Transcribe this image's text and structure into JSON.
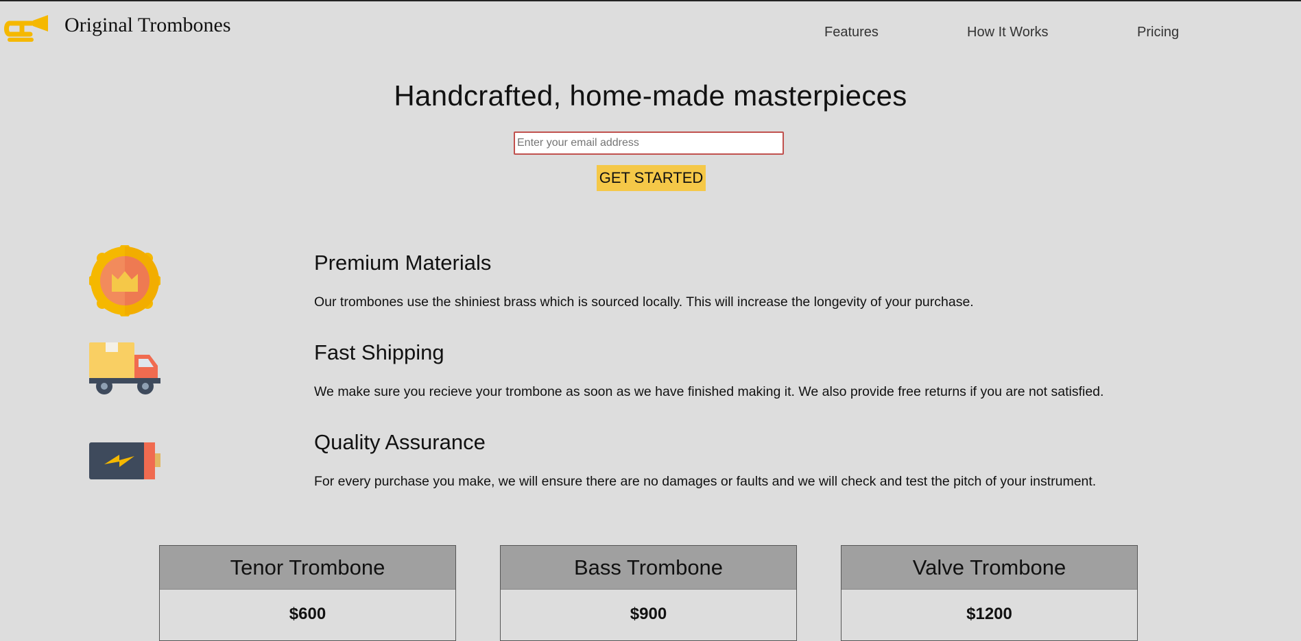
{
  "header": {
    "brand": "Original Trombones",
    "logo_icon": "trombone-icon",
    "nav": [
      {
        "label": "Features"
      },
      {
        "label": "How It Works"
      },
      {
        "label": "Pricing"
      }
    ]
  },
  "hero": {
    "title": "Handcrafted, home-made masterpieces",
    "email_placeholder": "Enter your email address",
    "email_value": "",
    "cta_label": "GET STARTED"
  },
  "features": [
    {
      "icon": "medal-icon",
      "title": "Premium Materials",
      "description": "Our trombones use the shiniest brass which is sourced locally. This will increase the longevity of your purchase."
    },
    {
      "icon": "delivery-truck-icon",
      "title": "Fast Shipping",
      "description": "We make sure you recieve your trombone as soon as we have finished making it. We also provide free returns if you are not satisfied."
    },
    {
      "icon": "battery-icon",
      "title": "Quality Assurance",
      "description": "For every purchase you make, we will ensure there are no damages or faults and we will check and test the pitch of your instrument."
    }
  ],
  "pricing": [
    {
      "name": "Tenor Trombone",
      "price": "$600"
    },
    {
      "name": "Bass Trombone",
      "price": "$900"
    },
    {
      "name": "Valve Trombone",
      "price": "$1200"
    }
  ],
  "colors": {
    "background": "#dddddd",
    "cta": "#f5c848",
    "input_border": "#c0504d",
    "card_header": "#a0a0a0",
    "logo": "#f5b800"
  }
}
